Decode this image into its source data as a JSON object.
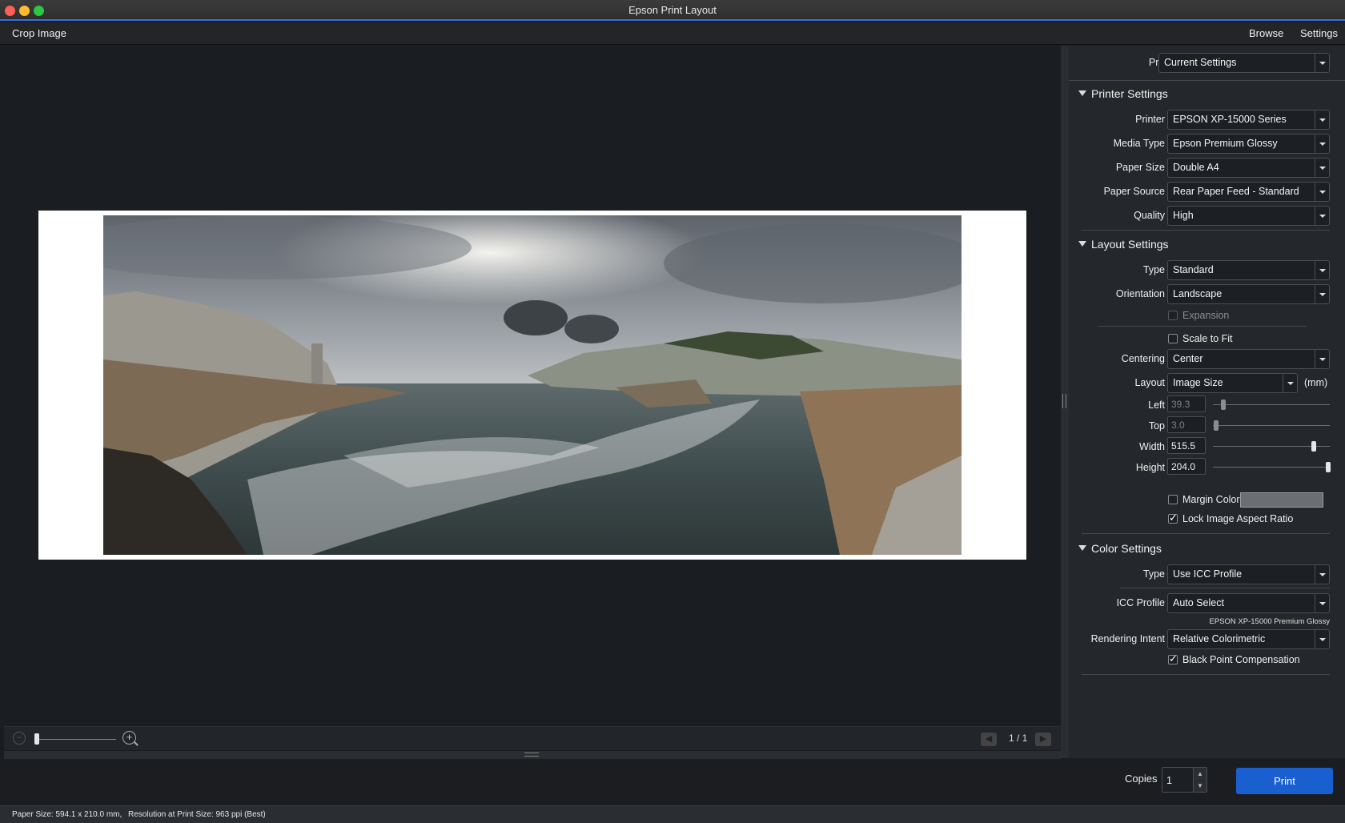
{
  "window": {
    "title": "Epson Print Layout"
  },
  "menubar": {
    "left": "Crop Image",
    "browse": "Browse",
    "settings": "Settings"
  },
  "preview_bar": {
    "page": "1 / 1"
  },
  "preset": {
    "label": "Preset",
    "value": "Current Settings"
  },
  "printer_settings": {
    "title": "Printer Settings",
    "printer": {
      "label": "Printer",
      "value": "EPSON XP-15000 Series"
    },
    "media_type": {
      "label": "Media Type",
      "value": "Epson Premium Glossy"
    },
    "paper_size": {
      "label": "Paper Size",
      "value": "Double A4"
    },
    "paper_source": {
      "label": "Paper Source",
      "value": "Rear Paper Feed - Standard"
    },
    "quality": {
      "label": "Quality",
      "value": "High"
    }
  },
  "layout_settings": {
    "title": "Layout Settings",
    "type": {
      "label": "Type",
      "value": "Standard"
    },
    "orientation": {
      "label": "Orientation",
      "value": "Landscape"
    },
    "expansion": {
      "label": "Expansion",
      "checked": false
    },
    "scale_to_fit": {
      "label": "Scale to Fit",
      "checked": false
    },
    "centering": {
      "label": "Centering",
      "value": "Center"
    },
    "layout": {
      "label": "Layout",
      "value": "Image Size",
      "unit": "(mm)"
    },
    "left": {
      "label": "Left",
      "value": "39.3"
    },
    "top": {
      "label": "Top",
      "value": "3.0"
    },
    "width": {
      "label": "Width",
      "value": "515.5"
    },
    "height": {
      "label": "Height",
      "value": "204.0"
    },
    "margin_color": {
      "label": "Margin Color",
      "checked": false
    },
    "lock_aspect": {
      "label": "Lock Image Aspect Ratio",
      "checked": true
    }
  },
  "color_settings": {
    "title": "Color Settings",
    "type": {
      "label": "Type",
      "value": "Use ICC Profile"
    },
    "icc_profile": {
      "label": "ICC Profile",
      "value": "Auto Select",
      "note": "EPSON XP-15000 Premium Glossy"
    },
    "rendering_intent": {
      "label": "Rendering Intent",
      "value": "Relative Colorimetric"
    },
    "black_point": {
      "label": "Black Point Compensation",
      "checked": true
    }
  },
  "bottom": {
    "copies_label": "Copies",
    "copies_value": "1",
    "print_label": "Print"
  },
  "status": {
    "paper_size": "Paper Size: 594.1 x 210.0 mm,",
    "resolution": "Resolution at Print Size: 963 ppi (Best)"
  },
  "colors": {
    "accent": "#1a5fd0",
    "panel": "#24272b",
    "preview": "#1a1d21"
  }
}
